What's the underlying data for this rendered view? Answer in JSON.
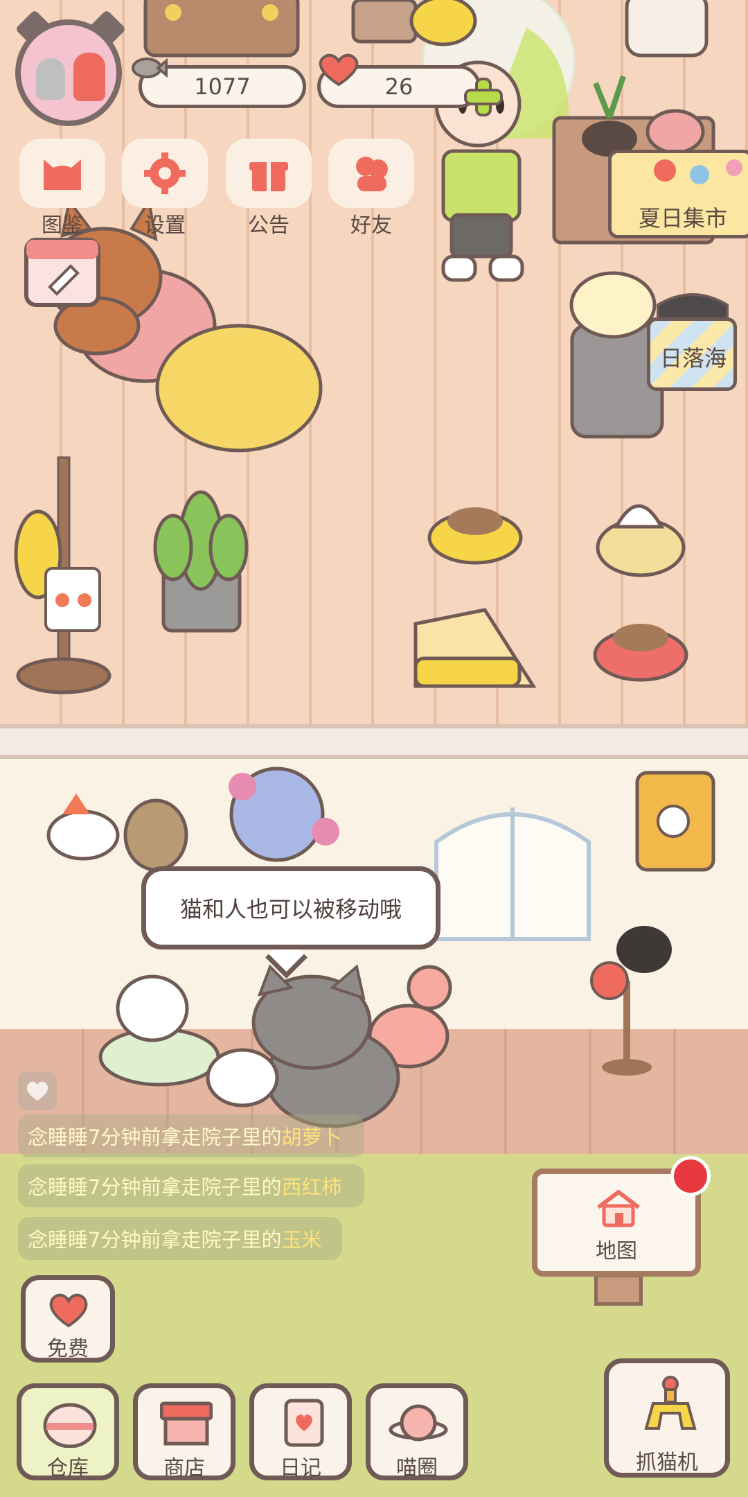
{
  "hud": {
    "fish_count": "1077",
    "heart_count": "26",
    "fish_icon": "fish-icon",
    "heart_icon": "heart-icon",
    "add_icon": "plus-icon"
  },
  "menu": [
    {
      "label": "图鉴",
      "icon": "cat-head-icon"
    },
    {
      "label": "设置",
      "icon": "gear-icon"
    },
    {
      "label": "公告",
      "icon": "gift-icon"
    },
    {
      "label": "好友",
      "icon": "friends-icon"
    }
  ],
  "places": {
    "summer_market": "夏日集市",
    "sunset_sea": "日落海"
  },
  "bubble_text": "猫和人也可以被移动哦",
  "feed": [
    {
      "who": "念睡睡",
      "text": "7分钟前拿走院子里的",
      "item": "胡萝卜"
    },
    {
      "who": "念睡睡",
      "text": "7分钟前拿走院子里的",
      "item": "西红柿"
    },
    {
      "who": "念睡睡",
      "text": "7分钟前拿走院子里的",
      "item": "玉米"
    }
  ],
  "map": {
    "label": "地图",
    "icon": "house-icon"
  },
  "free": {
    "label": "免费",
    "icon": "heart-icon"
  },
  "bottom_nav": [
    {
      "label": "仓库",
      "icon": "storage-icon",
      "active": true
    },
    {
      "label": "商店",
      "icon": "shop-icon",
      "active": false
    },
    {
      "label": "日记",
      "icon": "diary-icon",
      "active": false
    },
    {
      "label": "喵圈",
      "icon": "planet-cat-icon",
      "active": false
    }
  ],
  "claw_machine": {
    "label": "抓猫机",
    "icon": "claw-icon"
  },
  "colors": {
    "outline": "#6f5a55",
    "accent_red": "#ef6b5d",
    "yard_green": "#d4d98c",
    "notification_red": "#e8393f"
  }
}
